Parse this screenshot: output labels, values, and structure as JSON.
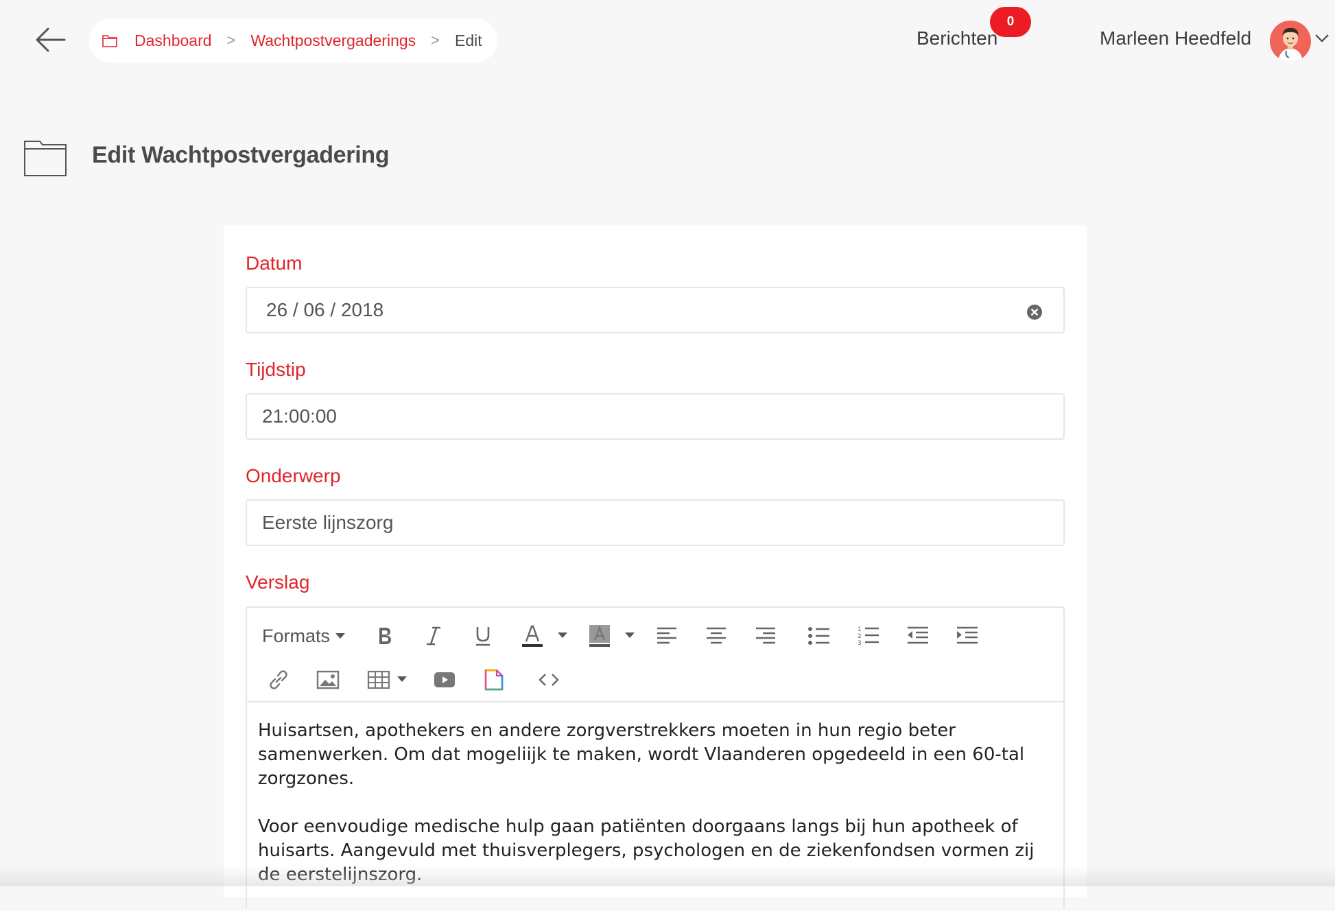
{
  "breadcrumb": {
    "items": [
      "Dashboard",
      "Wachtpostvergaderings"
    ],
    "current": "Edit",
    "separator": ">"
  },
  "header": {
    "messages_label": "Berichten",
    "messages_count": "0",
    "user_name": "Marleen Heedfeld"
  },
  "page": {
    "title": "Edit Wachtpostvergadering"
  },
  "form": {
    "datum": {
      "label": "Datum",
      "value": "26 / 06 / 2018"
    },
    "tijdstip": {
      "label": "Tijdstip",
      "value": "21:00:00"
    },
    "onderwerp": {
      "label": "Onderwerp",
      "value": "Eerste lijnszorg"
    },
    "verslag": {
      "label": "Verslag",
      "toolbar": {
        "formats_label": "Formats",
        "buttons": [
          "bold",
          "italic",
          "underline",
          "text-color",
          "background-color",
          "align-left",
          "align-center",
          "align-right",
          "bullet-list",
          "numbered-list",
          "outdent",
          "indent",
          "link",
          "image",
          "table",
          "video",
          "document",
          "source-code"
        ]
      },
      "paragraphs": [
        "Huisartsen, apothekers en andere zorgverstrekkers moeten in hun regio beter samenwerken. Om dat mogeliijk te maken, wordt Vlaanderen opgedeeld in een 60-tal zorgzones.",
        "Voor eenvoudige medische hulp gaan patiënten doorgaans langs bij hun apotheek of huisarts. Aangevuld met thuisverplegers, psychologen en de ziekenfondsen vormen zij de eerstelijnszorg."
      ]
    }
  },
  "colors": {
    "accent": "#e0252b",
    "badge": "#ec1c24",
    "background": "#f7f7f7"
  }
}
